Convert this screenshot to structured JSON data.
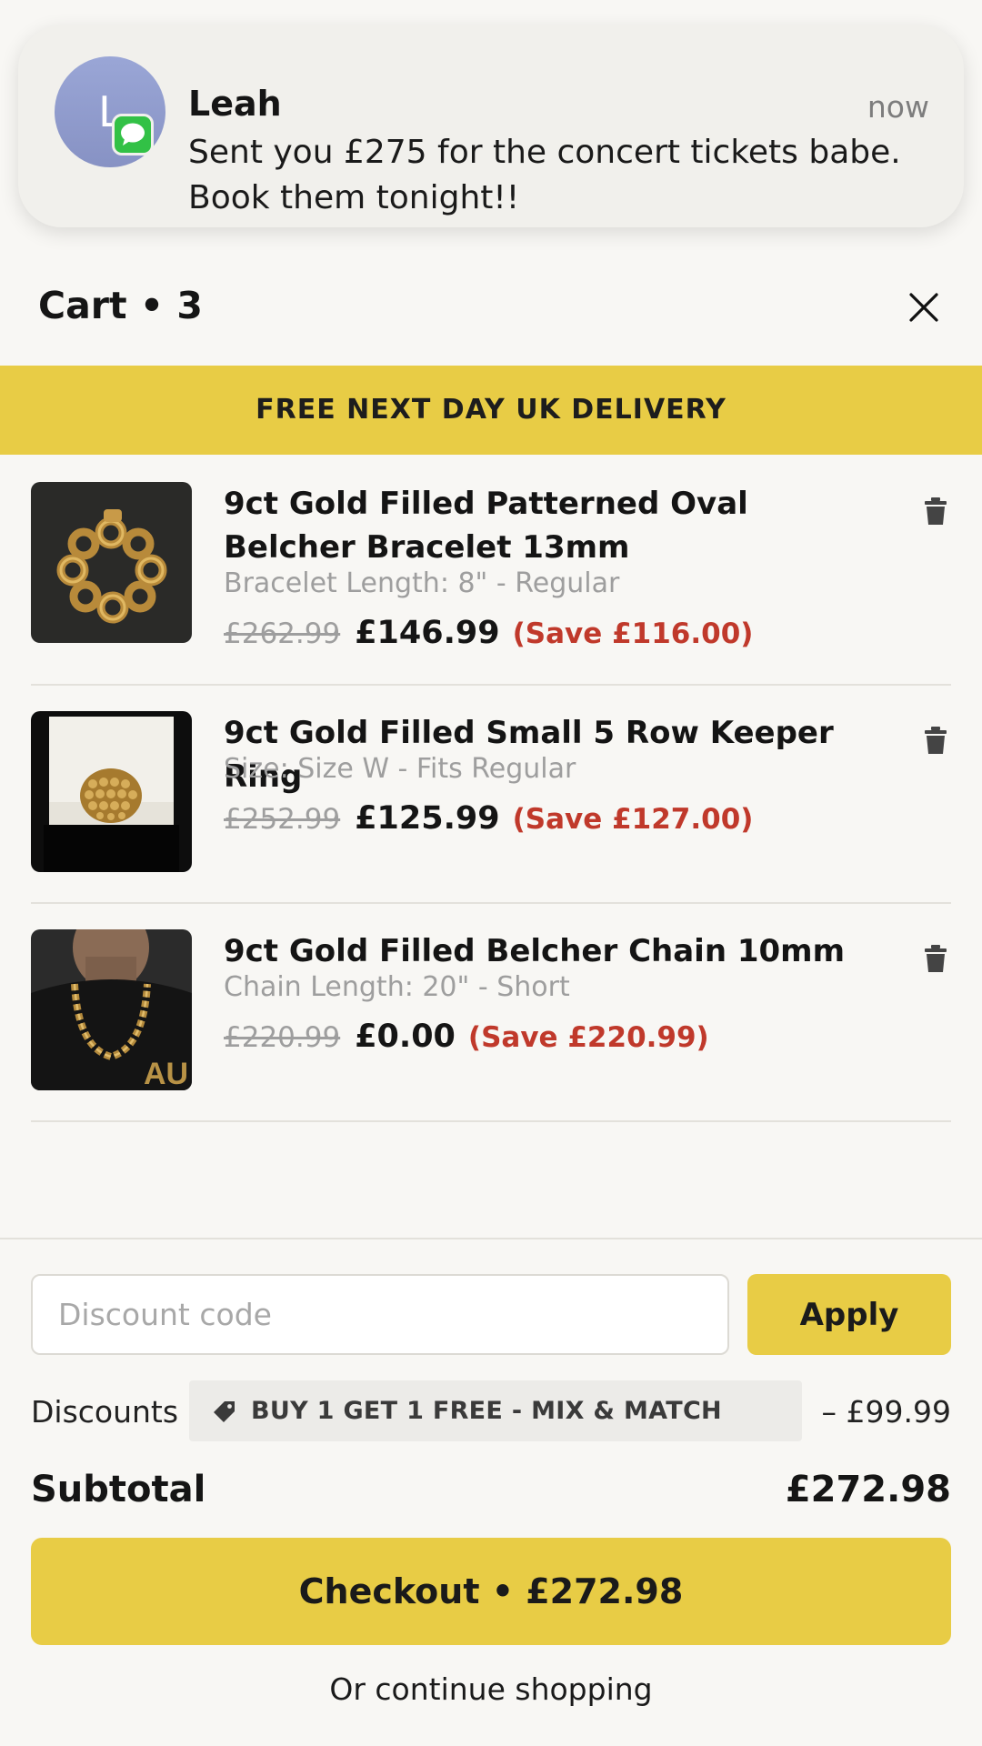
{
  "notification": {
    "avatar_initial": "L",
    "sender": "Leah",
    "time": "now",
    "message": "Sent you £275 for the concert tickets babe. Book them tonight!!"
  },
  "cart": {
    "title": "Cart • 3",
    "banner": "FREE NEXT DAY UK DELIVERY",
    "items": [
      {
        "name": "9ct Gold Filled Patterned Oval Belcher Bracelet 13mm",
        "variant": "Bracelet Length: 8\" - Regular",
        "price_old": "£262.99",
        "price_new": "£146.99",
        "save": "(Save £116.00)",
        "image": "bracelet"
      },
      {
        "name": "9ct Gold Filled Small 5 Row Keeper Ring",
        "variant": "Size: Size W - Fits Regular",
        "price_old": "£252.99",
        "price_new": "£125.99",
        "save": "(Save £127.00)",
        "image": "ring"
      },
      {
        "name": "9ct Gold Filled Belcher Chain 10mm",
        "variant": "Chain Length: 20\" - Short",
        "price_old": "£220.99",
        "price_new": "£0.00",
        "save": "(Save £220.99)",
        "image": "chain",
        "image_text": "AU"
      }
    ]
  },
  "discount": {
    "placeholder": "Discount code",
    "apply_label": "Apply",
    "label": "Discounts",
    "tag": "BUY 1 GET 1 FREE - MIX & MATCH",
    "amount": "– £99.99"
  },
  "summary": {
    "subtotal_label": "Subtotal",
    "subtotal_value": "£272.98",
    "checkout_label": "Checkout • £272.98",
    "continue_label": "Or continue shopping"
  },
  "colors": {
    "accent": "#e8cc45",
    "save_red": "#c0392b",
    "background": "#f8f7f4"
  }
}
